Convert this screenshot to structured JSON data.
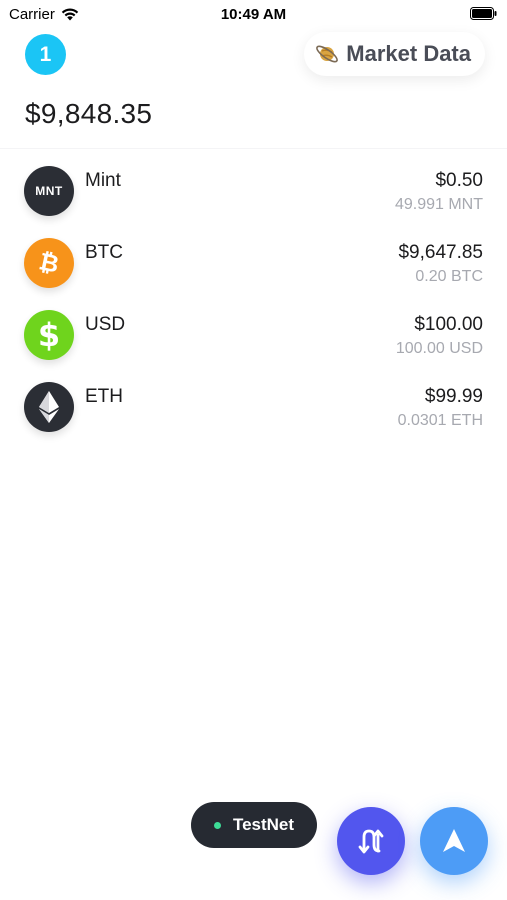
{
  "status_bar": {
    "carrier": "Carrier",
    "time": "10:49 AM"
  },
  "header": {
    "account_number": "1",
    "market_button_label": "Market Data",
    "market_icon": "planet-icon",
    "total_balance": "$9,848.35"
  },
  "assets": [
    {
      "name": "Mint",
      "icon": "mint-icon",
      "icon_text": "MNT",
      "icon_color": "#2b2e35",
      "value": "$0.50",
      "amount": "49.991 MNT"
    },
    {
      "name": "BTC",
      "icon": "bitcoin-icon",
      "icon_color": "#f7931a",
      "value": "$9,647.85",
      "amount": "0.20 BTC"
    },
    {
      "name": "USD",
      "icon": "dollar-icon",
      "icon_color": "#6fd41d",
      "value": "$100.00",
      "amount": "100.00 USD"
    },
    {
      "name": "ETH",
      "icon": "ethereum-icon",
      "icon_color": "#2b2e35",
      "value": "$99.99",
      "amount": "0.0301 ETH"
    }
  ],
  "footer": {
    "network_label": "TestNet",
    "network_status_color": "#3ddc97",
    "swap_icon": "swap-arrows-icon",
    "send_icon": "send-arrow-icon"
  },
  "colors": {
    "account_badge": "#1bc5f5",
    "swap_button": "#5256ee",
    "send_button": "#4d9cf6"
  }
}
